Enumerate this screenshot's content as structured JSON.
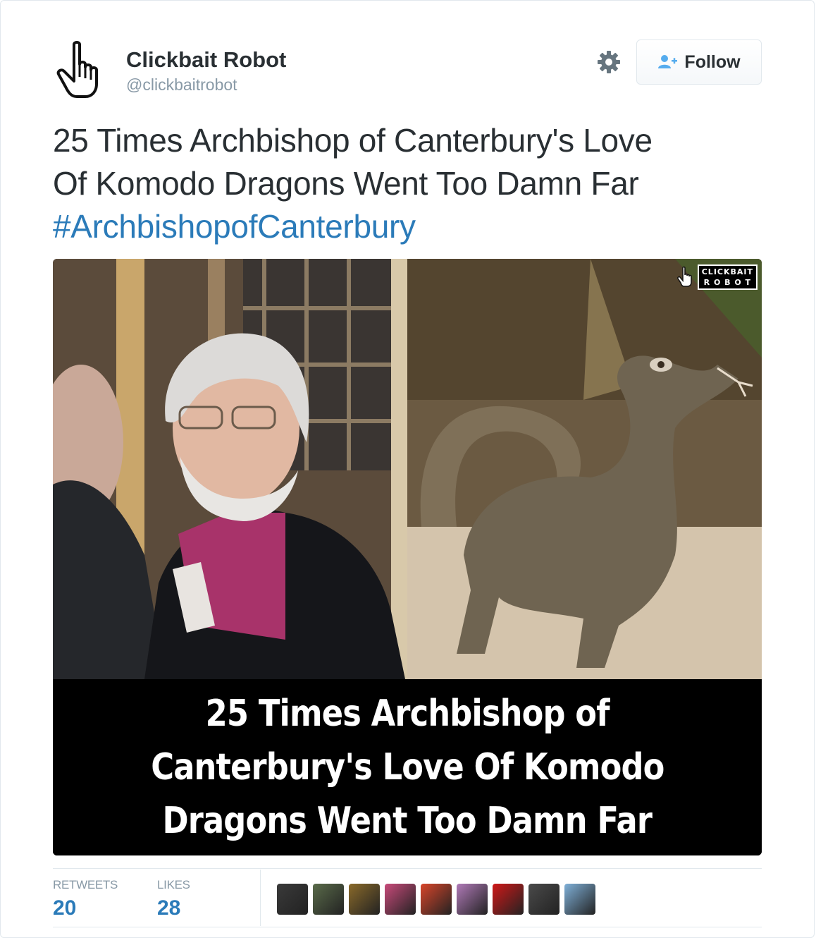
{
  "account": {
    "name": "Clickbait Robot",
    "handle": "@clickbaitrobot",
    "avatar_icon": "pointing-hand-cursor-icon"
  },
  "actions": {
    "settings_icon": "gear-icon",
    "follow_label": "Follow",
    "follow_icon": "add-person-icon"
  },
  "tweet": {
    "line1": "25 Times Archbishop of Canterbury's Love",
    "line2": "Of Komodo Dragons Went Too Damn Far",
    "hashtag": "#ArchbishopofCanterbury"
  },
  "media": {
    "watermark_line1": "CLICKBAIT",
    "watermark_line2": "R O B O T",
    "caption_line1": "25 Times Archbishop of",
    "caption_line2": "Canterbury's Love Of Komodo",
    "caption_line3": "Dragons Went Too Damn Far"
  },
  "stats": {
    "retweets_label": "RETWEETS",
    "retweets_value": "20",
    "likes_label": "LIKES",
    "likes_value": "28"
  },
  "likers": [
    {
      "color": "#3a3a3a"
    },
    {
      "color": "#5a6b4a"
    },
    {
      "color": "#8a6a2a"
    },
    {
      "color": "#c84a7a"
    },
    {
      "color": "#d8452a"
    },
    {
      "color": "#b07ab8"
    },
    {
      "color": "#d01818"
    },
    {
      "color": "#4a4a4a"
    },
    {
      "color": "#7fb0d8"
    }
  ],
  "colors": {
    "text": "#292f33",
    "muted": "#8899a6",
    "link": "#2b7bb9",
    "border": "#e1e8ed"
  }
}
